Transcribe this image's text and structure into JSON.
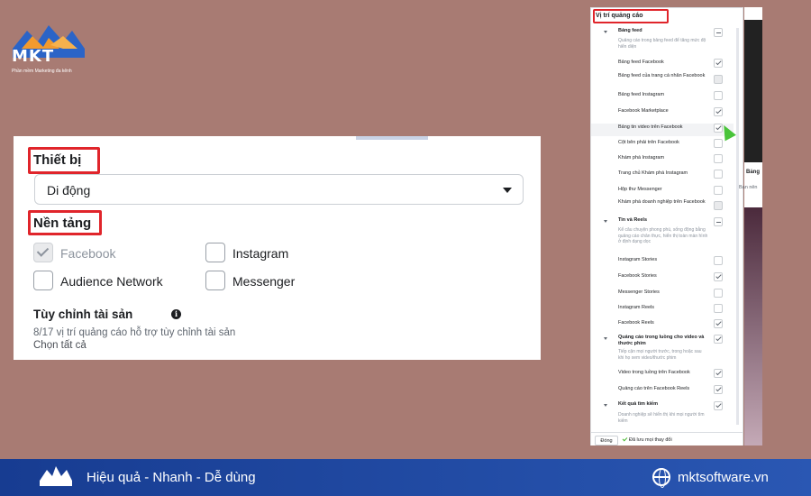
{
  "brand": {
    "logo_text": "MKT",
    "logo_subtitle": "Phần mềm Marketing đa kênh",
    "colors": {
      "blue": "#2b64c7",
      "orange": "#f29a2e",
      "footer": "#1f4aa5"
    }
  },
  "left_panel": {
    "device_label": "Thiết bị",
    "device_value": "Di động",
    "platform_label": "Nền tảng",
    "platforms": [
      {
        "label": "Facebook",
        "checked": true,
        "disabled": true
      },
      {
        "label": "Instagram",
        "checked": false,
        "disabled": false
      },
      {
        "label": "Audience Network",
        "checked": false,
        "disabled": false
      },
      {
        "label": "Messenger",
        "checked": false,
        "disabled": false
      }
    ],
    "asset_title": "Tùy chỉnh tài sản",
    "asset_info": "8/17 vị trí quảng cáo hỗ trợ tùy chỉnh tài sản",
    "select_all": "Chọn tất cả",
    "highlight_color": "#e0252b"
  },
  "right_panel": {
    "title": "Vị trí quảng cáo",
    "sections": [
      {
        "name": "Bảng feed",
        "desc": "Quảng cáo trong bảng feed để tăng mức độ hiển diện",
        "items": [
          {
            "label": "Bảng feed Facebook",
            "checked": true
          },
          {
            "label": "Bảng feed của trang cá nhân Facebook",
            "checked": false
          },
          {
            "label": "Bảng feed Instagram",
            "checked": false
          },
          {
            "label": "Facebook Marketplace",
            "checked": true
          },
          {
            "label": "Bảng tin video trên Facebook",
            "checked": true
          },
          {
            "label": "Cột bên phải trên Facebook",
            "checked": false
          },
          {
            "label": "Khám phá Instagram",
            "checked": false
          },
          {
            "label": "Trang chủ Khám phá Instagram",
            "checked": false
          },
          {
            "label": "Hộp thư Messenger",
            "checked": false
          },
          {
            "label": "Khám phá doanh nghiệp trên Facebook",
            "checked": false
          }
        ]
      },
      {
        "name": "Tin và Reels",
        "desc": "Kể câu chuyện phong phú, sống động bằng quảng cáo chân thực, hiển thị toàn màn hình ở định dạng dọc",
        "items": [
          {
            "label": "Instagram Stories",
            "checked": false
          },
          {
            "label": "Facebook Stories",
            "checked": true
          },
          {
            "label": "Messenger Stories",
            "checked": false
          },
          {
            "label": "Instagram Reels",
            "checked": false
          },
          {
            "label": "Facebook Reels",
            "checked": true
          }
        ]
      },
      {
        "name": "Quảng cáo trong luồng cho video và thước phim",
        "desc": "Tiếp cận mọi người trước, trong hoặc sau khi họ xem video/thước phim",
        "items": [
          {
            "label": "Video trong luồng trên Facebook",
            "checked": true
          },
          {
            "label": "Quảng cáo trên Facebook Reels",
            "checked": true
          }
        ]
      },
      {
        "name": "Kết quả tìm kiếm",
        "desc": "Doanh nghiệp sẽ hiển thị khi mọi người tìm kiếm",
        "items": []
      }
    ],
    "close_button": "Đóng",
    "saved_text": "Đã lưu mọi thay đổi",
    "side_heading": "Bảng",
    "side_sub": "Bạn nên"
  },
  "footer": {
    "slogan": "Hiệu quả - Nhanh - Dễ dùng",
    "website": "mktsoftware.vn"
  }
}
